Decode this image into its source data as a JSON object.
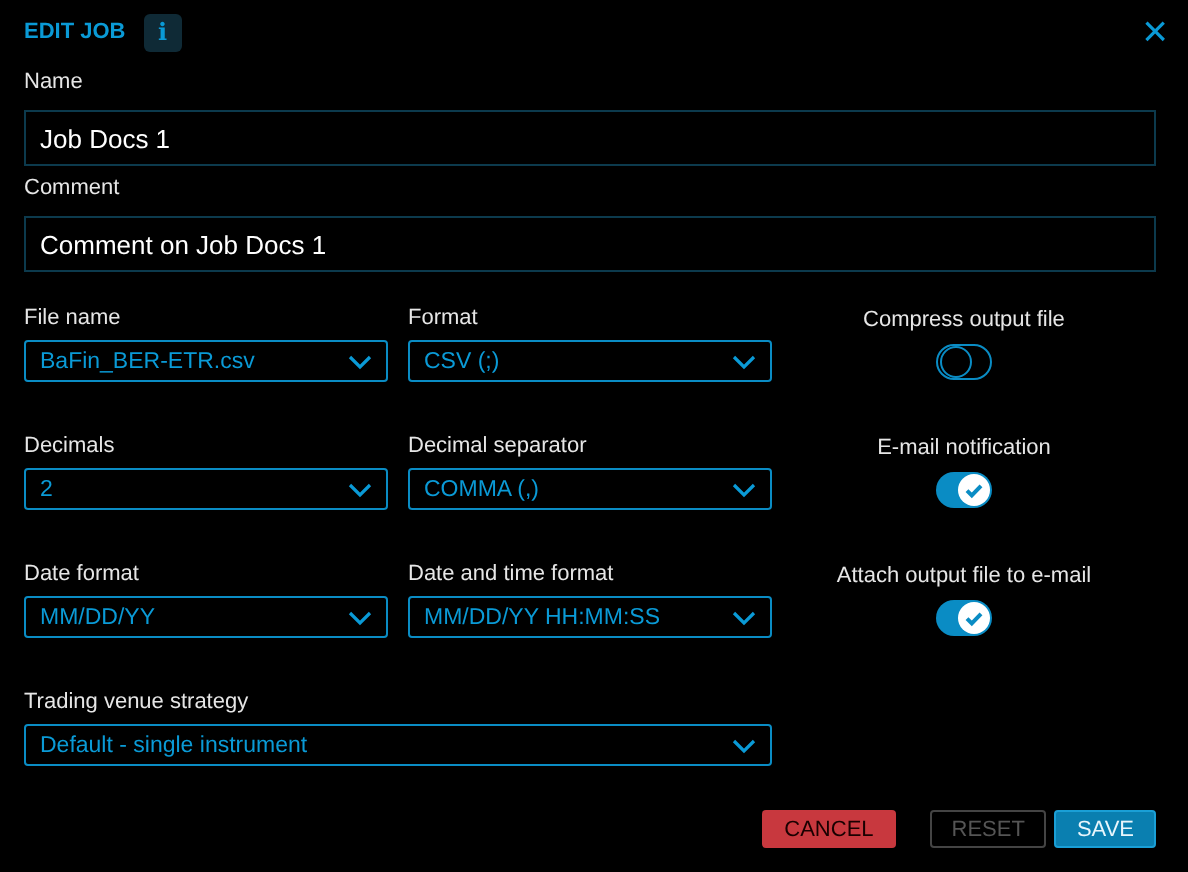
{
  "dialog": {
    "title": "EDIT JOB",
    "info_icon": "i",
    "close_icon": "×"
  },
  "text_fields": [
    {
      "label": "Name",
      "value": "Job Docs 1"
    },
    {
      "label": "Comment",
      "value": "Comment on Job Docs 1"
    }
  ],
  "selects": [
    {
      "label": "File name",
      "value": "BaFin_BER-ETR.csv",
      "wide": false
    },
    {
      "label": "Format",
      "value": "CSV (;)",
      "wide": false
    },
    {
      "label": "Decimals",
      "value": "2",
      "wide": false
    },
    {
      "label": "Decimal separator",
      "value": "COMMA (,)",
      "wide": false
    },
    {
      "label": "Date format",
      "value": "MM/DD/YY",
      "wide": false
    },
    {
      "label": "Date and time format",
      "value": "MM/DD/YY HH:MM:SS",
      "wide": false
    },
    {
      "label": "Trading venue strategy",
      "value": "Default - single instrument",
      "wide": true
    }
  ],
  "toggles": [
    {
      "label": "Compress output file",
      "on": false
    },
    {
      "label": "E-mail notification",
      "on": true
    },
    {
      "label": "Attach output file to e-mail",
      "on": true
    }
  ],
  "buttons": [
    {
      "label": "CANCEL",
      "kind": "cancel",
      "disabled": false
    },
    {
      "label": "RESET",
      "kind": "reset",
      "disabled": true
    },
    {
      "label": "SAVE",
      "kind": "save",
      "disabled": false
    }
  ]
}
